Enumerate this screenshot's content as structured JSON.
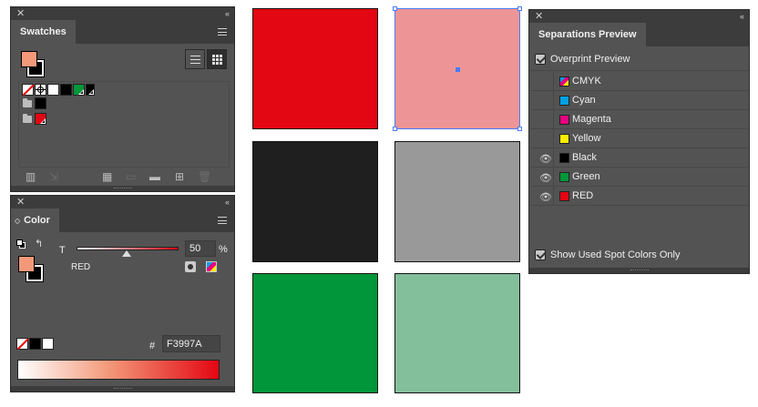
{
  "swatches_panel": {
    "title": "Swatches",
    "close_glyph": "✕",
    "collapse_glyph": "‹‹",
    "fill_color": "#f3997a",
    "items_row1": [
      "None",
      "Registration",
      "White",
      "Black",
      "Green"
    ],
    "groups": [
      {
        "swatches": [
          "Black"
        ]
      },
      {
        "swatches": [
          "RED"
        ]
      }
    ],
    "colors": {
      "none": "#ffffff",
      "registration": "#ffffff",
      "white": "#ffffff",
      "black": "#000000",
      "green": "#009639",
      "red": "#e30613"
    }
  },
  "color_panel": {
    "title": "Color",
    "tint_label": "T",
    "tint_value": "50",
    "percent_sign": "%",
    "slider_fraction": 0.5,
    "color_name": "RED",
    "hex_label": "#",
    "hex_value": "F3997A",
    "fill_color": "#f3997a"
  },
  "canvas": {
    "squares": [
      {
        "name": "red-square",
        "color": "#e30613",
        "selected": false
      },
      {
        "name": "pink-square",
        "color": "#ed9596",
        "selected": true
      },
      {
        "name": "black-square",
        "color": "#1f1f1f",
        "selected": false
      },
      {
        "name": "gray-square",
        "color": "#999999",
        "selected": false
      },
      {
        "name": "green-square",
        "color": "#009639",
        "selected": false
      },
      {
        "name": "light-green-square",
        "color": "#84bf9c",
        "selected": false
      }
    ],
    "selection_color": "#4a7bff"
  },
  "separations_panel": {
    "title": "Separations Preview",
    "overprint_label": "Overprint Preview",
    "overprint_checked": true,
    "separations": [
      {
        "label": "CMYK",
        "color": "cmyk",
        "visible": false
      },
      {
        "label": "Cyan",
        "color": "#00a0e3",
        "visible": false
      },
      {
        "label": "Magenta",
        "color": "#e5007e",
        "visible": false
      },
      {
        "label": "Yellow",
        "color": "#ffed00",
        "visible": false
      },
      {
        "label": "Black",
        "color": "#000000",
        "visible": true
      },
      {
        "label": "Green",
        "color": "#009639",
        "visible": true
      },
      {
        "label": "RED",
        "color": "#e30613",
        "visible": true
      }
    ],
    "show_used_label": "Show Used Spot Colors Only",
    "show_used_checked": true
  }
}
